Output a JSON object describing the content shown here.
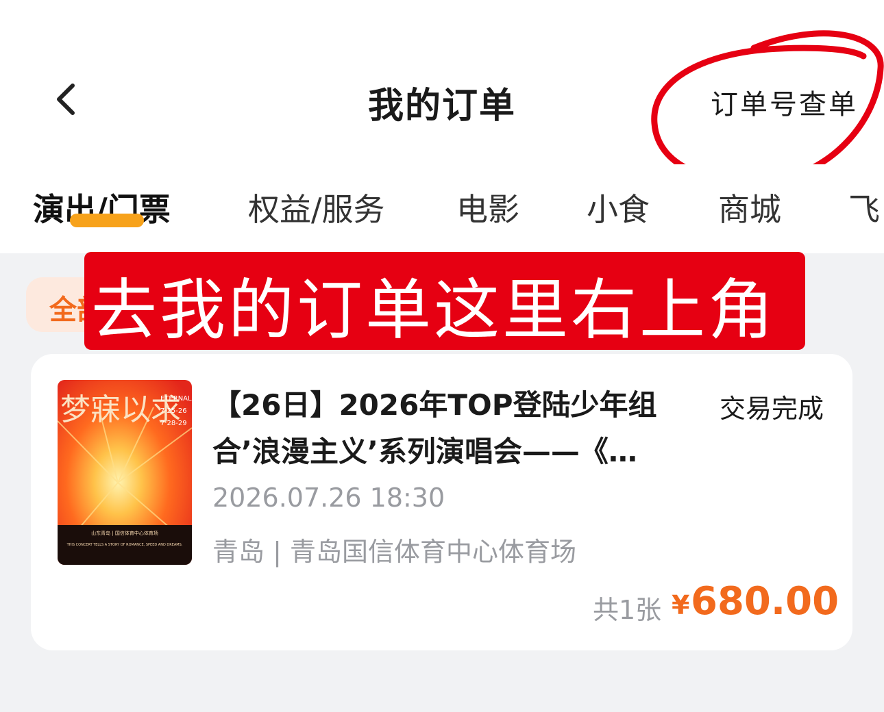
{
  "header": {
    "title": "我的订单",
    "action_label": "订单号查单"
  },
  "tabs": [
    {
      "label": "演出/门票"
    },
    {
      "label": "权益/服务"
    },
    {
      "label": "电影"
    },
    {
      "label": "小食"
    },
    {
      "label": "商城"
    },
    {
      "label": "飞"
    }
  ],
  "filter": {
    "label": "全部"
  },
  "banner": {
    "text": "去我的订单这里右上角"
  },
  "order": {
    "title": "【26日】2026年TOP登陆少年组合’浪漫主义’系列演唱会——《…",
    "status": "交易完成",
    "datetime": "2026.07.26 18:30",
    "venue": "青岛 | 青岛国信体育中心体育场",
    "ticket_count": "共1张",
    "price_symbol": "¥",
    "price": "680.00",
    "poster": {
      "title": "梦寐以求",
      "side_text": "ETERNAL BLOSSOM",
      "dates": "7·25-26",
      "dates_2": "7·28-29",
      "venue_line": "山东青岛 | 国信体育中心体育场",
      "tagline": "THIS CONCERT TELLS A STORY OF ROMANCE, SPEED AND DREAMS."
    }
  },
  "colors": {
    "accent": "#f26a1d",
    "tab_indicator": "#f7a21b",
    "banner": "#e60012",
    "annotation_circle": "#e60012",
    "background": "#f1f2f4"
  }
}
